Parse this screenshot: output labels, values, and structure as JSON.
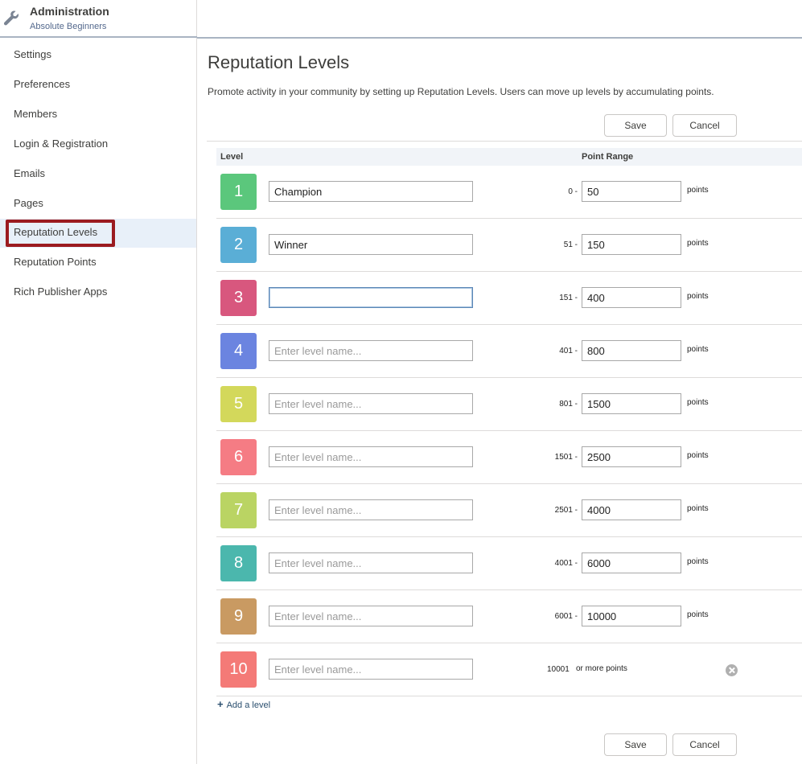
{
  "sidebar": {
    "title": "Administration",
    "subtitle": "Absolute Beginners",
    "items": [
      {
        "label": "Settings"
      },
      {
        "label": "Preferences"
      },
      {
        "label": "Members"
      },
      {
        "label": "Login & Registration"
      },
      {
        "label": "Emails"
      },
      {
        "label": "Pages"
      },
      {
        "label": "Reputation Levels",
        "active": true
      },
      {
        "label": "Reputation Points"
      },
      {
        "label": "Rich Publisher Apps"
      }
    ]
  },
  "main": {
    "title": "Reputation Levels",
    "description": "Promote activity in your community by setting up Reputation Levels. Users can move up levels by accumulating points.",
    "save_label": "Save",
    "cancel_label": "Cancel",
    "col_level": "Level",
    "col_range": "Point Range",
    "name_placeholder": "Enter level name...",
    "points_label": "points",
    "or_more_label": "or more points",
    "add_level_label": "Add a level",
    "add_icon": "+"
  },
  "levels": [
    {
      "num": "1",
      "name": "Champion",
      "start": "0 -",
      "end": "50",
      "color": "#5bc77c"
    },
    {
      "num": "2",
      "name": "Winner",
      "start": "51 -",
      "end": "150",
      "color": "#5aaed6"
    },
    {
      "num": "3",
      "name": "",
      "start": "151 -",
      "end": "400",
      "color": "#d8577e"
    },
    {
      "num": "4",
      "name": "",
      "start": "401 -",
      "end": "800",
      "color": "#6b84e0"
    },
    {
      "num": "5",
      "name": "",
      "start": "801 -",
      "end": "1500",
      "color": "#d3d85b"
    },
    {
      "num": "6",
      "name": "",
      "start": "1501 -",
      "end": "2500",
      "color": "#f57c84"
    },
    {
      "num": "7",
      "name": "",
      "start": "2501 -",
      "end": "4000",
      "color": "#bad463"
    },
    {
      "num": "8",
      "name": "",
      "start": "4001 -",
      "end": "6000",
      "color": "#4bb7ad"
    },
    {
      "num": "9",
      "name": "",
      "start": "6001 -",
      "end": "10000",
      "color": "#c99a62"
    },
    {
      "num": "10",
      "name": "",
      "start": "10001",
      "end": "",
      "color": "#f47a77"
    }
  ]
}
